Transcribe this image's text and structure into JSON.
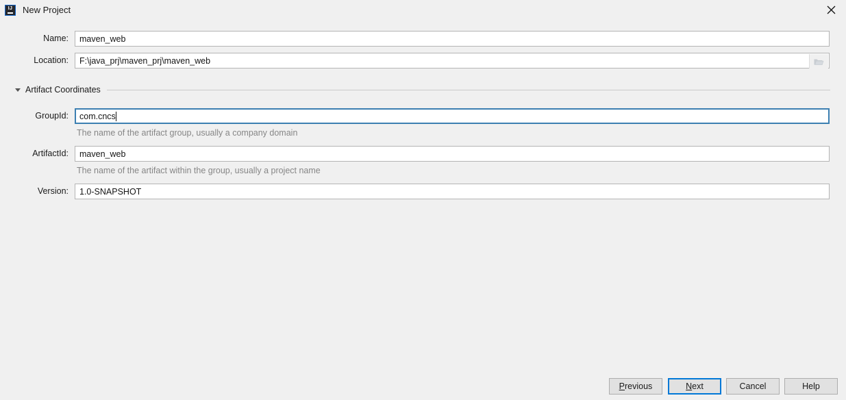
{
  "window": {
    "title": "New Project",
    "icon": "intellij-idea-icon",
    "icon_text": "IJ",
    "close_icon": "close-icon",
    "background_color": "#f0f0f0"
  },
  "form": {
    "name": {
      "label": "Name:",
      "value": "maven_web",
      "placeholder": "",
      "focused": false
    },
    "location": {
      "label": "Location:",
      "value": "F:\\java_prj\\maven_prj\\maven_web",
      "placeholder": "",
      "focused": false,
      "browse_icon": "folder-icon"
    }
  },
  "section": {
    "title": "Artifact Coordinates",
    "expanded": true,
    "collapse_icon": "chevron-down-icon"
  },
  "artifact": {
    "group_id": {
      "label": "GroupId:",
      "value": "com.cncs",
      "placeholder": "",
      "focused": true,
      "hint": "The name of the artifact group, usually a company domain"
    },
    "artifact_id": {
      "label": "ArtifactId:",
      "value": "maven_web",
      "placeholder": "",
      "focused": false,
      "hint": "The name of the artifact within the group, usually a project name"
    },
    "version": {
      "label": "Version:",
      "value": "1.0-SNAPSHOT",
      "placeholder": "",
      "focused": false
    }
  },
  "buttons": {
    "previous": {
      "label": "Previous",
      "mnemonic": "P",
      "default": false
    },
    "next": {
      "label": "Next",
      "mnemonic": "N",
      "default": true
    },
    "cancel": {
      "label": "Cancel",
      "mnemonic": "",
      "default": false
    },
    "help": {
      "label": "Help",
      "mnemonic": "",
      "default": false
    }
  },
  "colors": {
    "accent_focus": "#0078d7",
    "field_border": "#b4b4b4",
    "focus_border": "#3c7fb1",
    "hint_text": "#868686",
    "background": "#f0f0f0"
  }
}
